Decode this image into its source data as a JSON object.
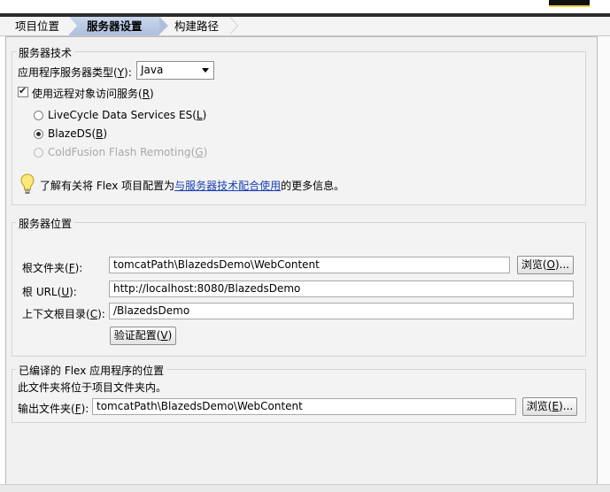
{
  "breadcrumb": {
    "step1": "项目位置",
    "step2": "服务器设置",
    "step3": "构建路径"
  },
  "server_tech": {
    "title": "服务器技术",
    "type_label_pre": "应用程序服务器类型(",
    "type_label_key": "Y",
    "type_label_post": "):",
    "type_value": "Java",
    "remote_checkbox_pre": "使用远程对象访问服务(",
    "remote_checkbox_key": "R",
    "remote_checkbox_post": ")",
    "remote_checked": true,
    "radio1_pre": "LiveCycle Data Services ES(",
    "radio1_key": "L",
    "radio1_post": ")",
    "radio2_pre": "BlazeDS(",
    "radio2_key": "B",
    "radio2_post": ")",
    "radio2_selected": true,
    "radio3_pre": "ColdFusion Flash Remoting(",
    "radio3_key": "G",
    "radio3_post": ")",
    "info_pre": "了解有关将 Flex 项目配置为",
    "info_link": "与服务器技术配合使用",
    "info_post": "的更多信息。"
  },
  "server_location": {
    "title": "服务器位置",
    "root_folder_pre": "根文件夹(",
    "root_folder_key": "F",
    "root_folder_post": "):",
    "root_folder_value": "tomcatPath\\BlazedsDemo\\WebContent",
    "browse1_pre": "浏览(",
    "browse1_key": "O",
    "browse1_post": ")...",
    "root_url_pre": "根 URL(",
    "root_url_key": "U",
    "root_url_post": "):",
    "root_url_value": "http://localhost:8080/BlazedsDemo",
    "context_root_pre": "上下文根目录(",
    "context_root_key": "C",
    "context_root_post": "):",
    "context_root_value": "/BlazedsDemo",
    "validate_pre": "验证配置(",
    "validate_key": "V",
    "validate_post": ")"
  },
  "output": {
    "title": "已编译的 Flex 应用程序的位置",
    "note": "此文件夹将位于项目文件夹内。",
    "output_folder_pre": "输出文件夹(",
    "output_folder_key": "F",
    "output_folder_post": "):",
    "output_folder_value": "tomcatPath\\BlazedsDemo\\WebContent",
    "browse2_pre": "浏览(",
    "browse2_key": "E",
    "browse2_post": ")..."
  }
}
